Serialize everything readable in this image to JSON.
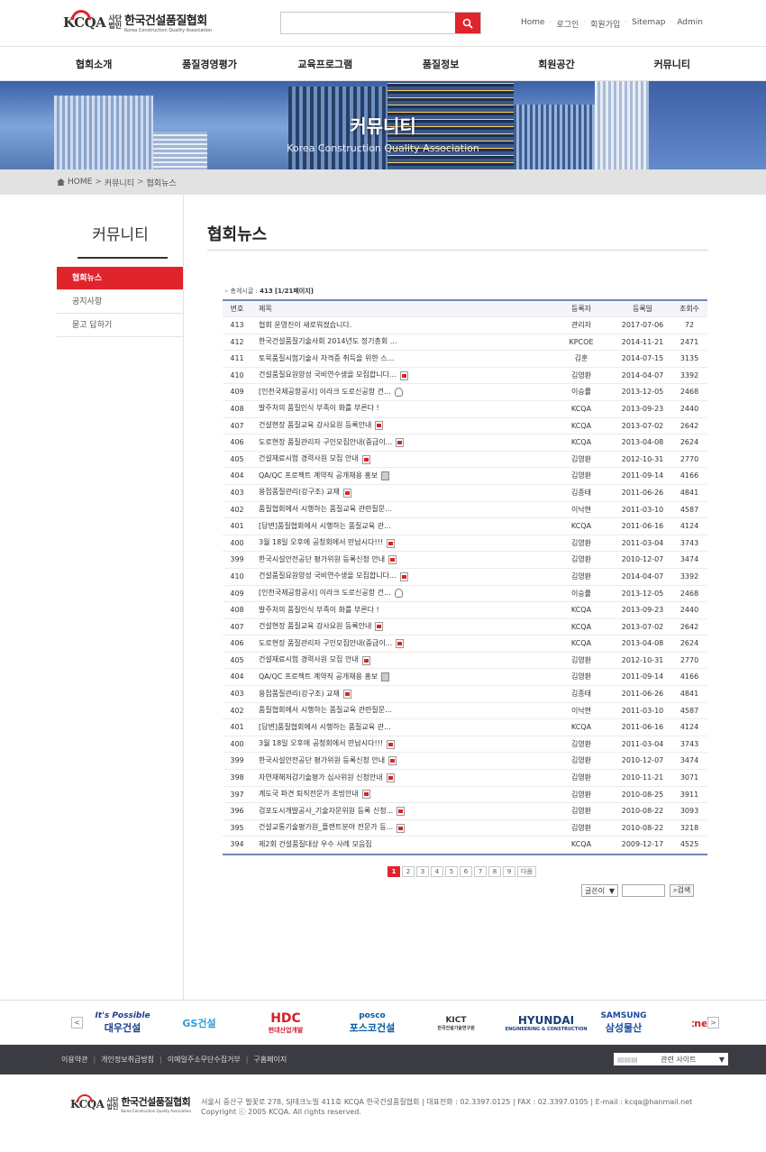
{
  "header": {
    "logo_mark": "KCQA",
    "logo_corp_1": "사단",
    "logo_corp_2": "법인",
    "logo_name": "한국건설품질협회",
    "logo_sub": "Korea Construction Quality Association",
    "search_placeholder": "",
    "util_links": [
      "Home",
      "로그인",
      "회원가입",
      "Sitemap",
      "Admin"
    ]
  },
  "gnb": [
    "협회소개",
    "품질경영평가",
    "교육프로그램",
    "품질정보",
    "회원공간",
    "커뮤니티"
  ],
  "banner": {
    "title": "커뮤니티",
    "subtitle": "Korea Construction Quality Association"
  },
  "breadcrumb": [
    "HOME",
    "커뮤니티",
    "협회뉴스"
  ],
  "sidebar": {
    "title": "커뮤니티",
    "items": [
      "협회뉴스",
      "공지사항",
      "묻고 답하기"
    ],
    "active": 0
  },
  "page_title": "협회뉴스",
  "board": {
    "total_label": "총게시글 :",
    "total_count": "413",
    "page_info": "[1/21페이지]",
    "columns": [
      "번호",
      "제목",
      "등록자",
      "등록일",
      "조회수"
    ],
    "rows": [
      {
        "no": "413",
        "title": "협회 운영진이 새로워졌습니다.",
        "icon": "",
        "author": "관리자",
        "date": "2017-07-06",
        "views": "72"
      },
      {
        "no": "412",
        "title": "한국건설품질기술사회 2014년도 정기총회 ...",
        "icon": "",
        "author": "KPCOE",
        "date": "2014-11-21",
        "views": "2471"
      },
      {
        "no": "411",
        "title": "토목품질시험기술사 자격증 취득을 위한 스...",
        "icon": "",
        "author": "김훈",
        "date": "2014-07-15",
        "views": "3135"
      },
      {
        "no": "410",
        "title": "건설품질요원양성 국비연수생을 모집합니다...",
        "icon": "doc",
        "author": "김영환",
        "date": "2014-04-07",
        "views": "3392"
      },
      {
        "no": "409",
        "title": "[인천국제공항공사] 이라크 도로신공항 건...",
        "icon": "bulb",
        "author": "이승률",
        "date": "2013-12-05",
        "views": "2468"
      },
      {
        "no": "408",
        "title": "발주처의 품질인식 부족이 화를 부른다 !",
        "icon": "",
        "author": "KCQA",
        "date": "2013-09-23",
        "views": "2440"
      },
      {
        "no": "407",
        "title": "건설현장 품질교육 강사요원 등록안내",
        "icon": "doc",
        "author": "KCQA",
        "date": "2013-07-02",
        "views": "2642"
      },
      {
        "no": "406",
        "title": "도로현장 품질관리자 구인모집안내(중급이...",
        "icon": "doc",
        "author": "KCQA",
        "date": "2013-04-08",
        "views": "2624"
      },
      {
        "no": "405",
        "title": "건설재료시험 경력사원 모집 안내",
        "icon": "doc",
        "author": "김영환",
        "date": "2012-10-31",
        "views": "2770"
      },
      {
        "no": "404",
        "title": "QA/QC 프로젝트 계약직 공개채용 홍보",
        "icon": "box",
        "author": "김영환",
        "date": "2011-09-14",
        "views": "4166"
      },
      {
        "no": "403",
        "title": "용접품질관리(강구조) 교재",
        "icon": "pdf",
        "author": "김종태",
        "date": "2011-06-26",
        "views": "4841"
      },
      {
        "no": "402",
        "title": "품질협회에서 시행하는 품질교육 관련질문...",
        "icon": "",
        "author": "이낙현",
        "date": "2011-03-10",
        "views": "4587"
      },
      {
        "no": "401",
        "title": "[답변]품질협회에서 시행하는 품질교육 관...",
        "icon": "",
        "author": "KCQA",
        "date": "2011-06-16",
        "views": "4124"
      },
      {
        "no": "400",
        "title": "3월 18일 오후에 공청회에서 만납시다!!!",
        "icon": "doc",
        "author": "김영환",
        "date": "2011-03-04",
        "views": "3743"
      },
      {
        "no": "399",
        "title": "한국시설안전공단 평가위원 등록신청 안내",
        "icon": "doc",
        "author": "김영환",
        "date": "2010-12-07",
        "views": "3474"
      },
      {
        "no": "410",
        "title": "건설품질요원양성 국비연수생을 모집합니다...",
        "icon": "doc",
        "author": "김영환",
        "date": "2014-04-07",
        "views": "3392"
      },
      {
        "no": "409",
        "title": "[인천국제공항공사] 이라크 도로신공항 건...",
        "icon": "bulb",
        "author": "이승률",
        "date": "2013-12-05",
        "views": "2468"
      },
      {
        "no": "408",
        "title": "발주처의 품질인식 부족이 화를 부른다 !",
        "icon": "",
        "author": "KCQA",
        "date": "2013-09-23",
        "views": "2440"
      },
      {
        "no": "407",
        "title": "건설현장 품질교육 강사요원 등록안내",
        "icon": "doc",
        "author": "KCQA",
        "date": "2013-07-02",
        "views": "2642"
      },
      {
        "no": "406",
        "title": "도로현장 품질관리자 구인모집안내(중급이...",
        "icon": "doc",
        "author": "KCQA",
        "date": "2013-04-08",
        "views": "2624"
      },
      {
        "no": "405",
        "title": "건설재료시험 경력사원 모집 안내",
        "icon": "doc",
        "author": "김영환",
        "date": "2012-10-31",
        "views": "2770"
      },
      {
        "no": "404",
        "title": "QA/QC 프로젝트 계약직 공개채용 홍보",
        "icon": "box",
        "author": "김영환",
        "date": "2011-09-14",
        "views": "4166"
      },
      {
        "no": "403",
        "title": "용접품질관리(강구조) 교재",
        "icon": "pdf",
        "author": "김종태",
        "date": "2011-06-26",
        "views": "4841"
      },
      {
        "no": "402",
        "title": "품질협회에서 시행하는 품질교육 관련질문...",
        "icon": "",
        "author": "이낙현",
        "date": "2011-03-10",
        "views": "4587"
      },
      {
        "no": "401",
        "title": "[답변]품질협회에서 시행하는 품질교육 관...",
        "icon": "",
        "author": "KCQA",
        "date": "2011-06-16",
        "views": "4124"
      },
      {
        "no": "400",
        "title": "3월 18일 오후에 공청회에서 만납시다!!!",
        "icon": "doc",
        "author": "김영환",
        "date": "2011-03-04",
        "views": "3743"
      },
      {
        "no": "399",
        "title": "한국시설안전공단 평가위원 등록신청 안내",
        "icon": "doc",
        "author": "김영환",
        "date": "2010-12-07",
        "views": "3474"
      },
      {
        "no": "398",
        "title": "자연재해저감기술평가 심사위원 신청안내",
        "icon": "doc",
        "author": "김영환",
        "date": "2010-11-21",
        "views": "3071"
      },
      {
        "no": "397",
        "title": "계도국 파견 퇴직전문가 초빙안내",
        "icon": "doc",
        "author": "김영환",
        "date": "2010-08-25",
        "views": "3911"
      },
      {
        "no": "396",
        "title": "검포도시개발공사_기술자문위원 등록 신청...",
        "icon": "doc",
        "author": "김영환",
        "date": "2010-08-22",
        "views": "3093"
      },
      {
        "no": "395",
        "title": "건설교통기술평가원_플랜트분야 전문가 등...",
        "icon": "pdf",
        "author": "김영환",
        "date": "2010-08-22",
        "views": "3218"
      },
      {
        "no": "394",
        "title": "제2회 건설품질대상 우수 사례 모음집",
        "icon": "",
        "author": "KCQA",
        "date": "2009-12-17",
        "views": "4525"
      }
    ]
  },
  "paging": {
    "pages": [
      "1",
      "2",
      "3",
      "4",
      "5",
      "6",
      "7",
      "8",
      "9"
    ],
    "current": "1",
    "next_label": "다음"
  },
  "search_form": {
    "select_value": "글쓴이",
    "button_label": "검색"
  },
  "partners": [
    {
      "line1": "It's Possible",
      "line2": "대우건설",
      "color": "#1b3f8f"
    },
    {
      "line1": "",
      "line2": "GS건설",
      "color": "#2a9fd6"
    },
    {
      "line1": "HDC",
      "line2": "현대산업개발",
      "color": "#d21f2b"
    },
    {
      "line1": "posco",
      "line2": "포스코건설",
      "color": "#0a5aa5"
    },
    {
      "line1": "KICT",
      "line2": "한국건설기술연구원",
      "color": "#333333"
    },
    {
      "line1": "HYUNDAI",
      "line2": "ENGINEERING & CONSTRUCTION",
      "color": "#173d7a"
    },
    {
      "line1": "SAMSUNG",
      "line2": "삼성물산",
      "color": "#1a4aa0"
    },
    {
      "line1": "",
      "line2": "Partner to",
      "color": "#cc2222"
    }
  ],
  "footer_links": [
    "이용약관",
    "개인정보취급방침",
    "이메일주소무단수집거부",
    "구홈페이지"
  ],
  "related_sites_label": "관련 사이트",
  "footer": {
    "address": "서울시 중산구 벌꽃로 278, SJ테크노빌 411호 KCQA 한국건설품질협회",
    "tel": "대표전화 : 02.3397.0125",
    "fax": "FAX : 02.3397.0105",
    "email": "E-mail : kcqa@hanmail.net",
    "copyright": "Copyright ⓒ 2005 KCQA. All rights reserved."
  },
  "colors": {
    "accent": "#e0242c",
    "board_line": "#6f8cb8",
    "footer_bar": "#3b3c41"
  }
}
